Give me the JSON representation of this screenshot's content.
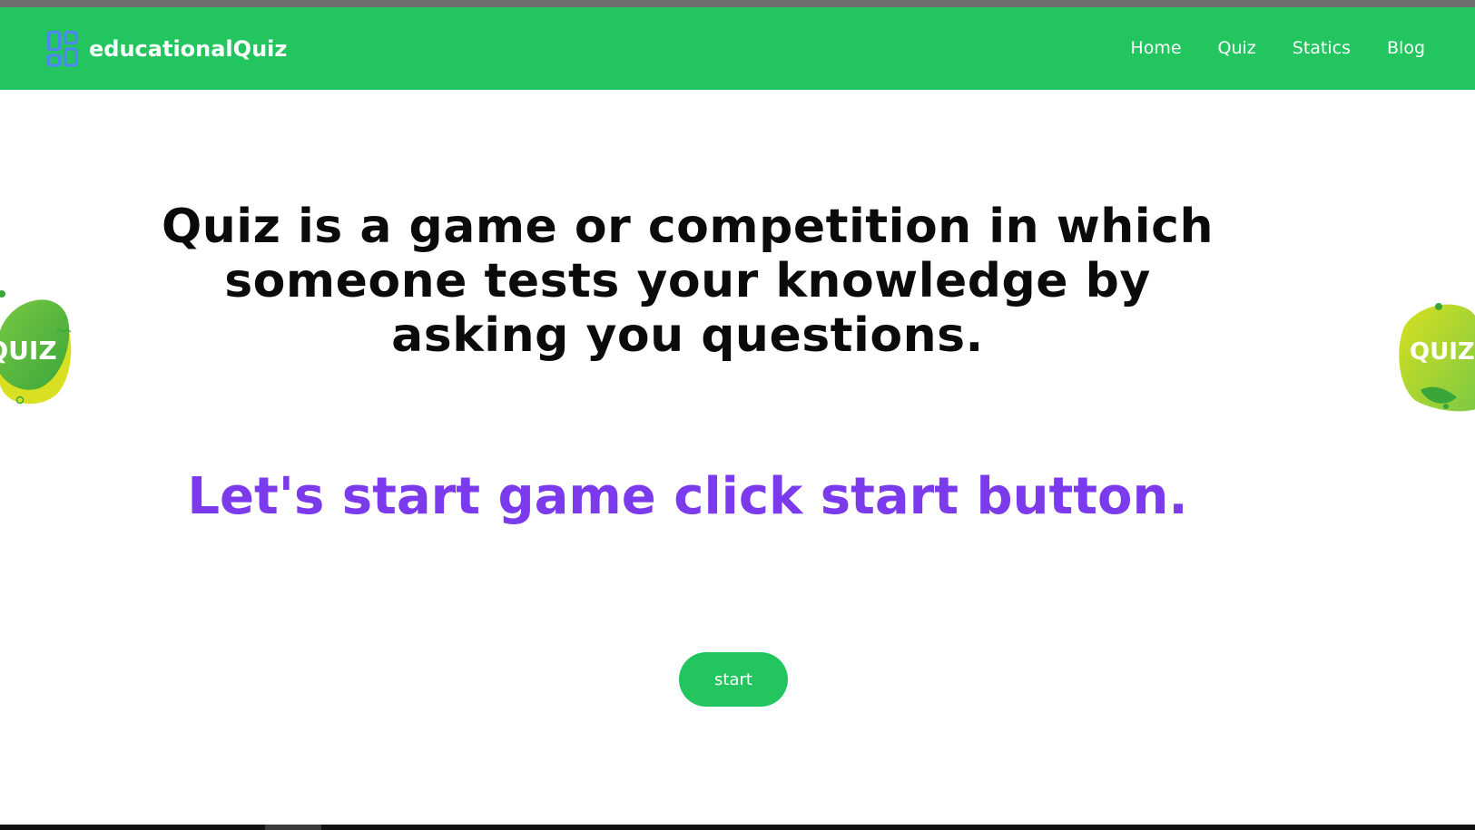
{
  "brand": {
    "name": "educationalQuiz",
    "icon": "dashboard-grid-icon"
  },
  "nav": {
    "items": [
      {
        "label": "Home"
      },
      {
        "label": "Quiz"
      },
      {
        "label": "Statics"
      },
      {
        "label": "Blog"
      }
    ]
  },
  "hero": {
    "headline": "Quiz is a game or competition in which someone tests your knowledge by asking you questions.",
    "subline": "Let's start game click start button.",
    "start_label": "start"
  },
  "badges": {
    "left_text": "QUIZ",
    "right_text": "QUIZ"
  },
  "colors": {
    "navbar": "#22c55e",
    "accent": "#7c3aed",
    "headline": "#0b0b0b",
    "button": "#22c55e",
    "brand_icon": "#4f86f7"
  }
}
